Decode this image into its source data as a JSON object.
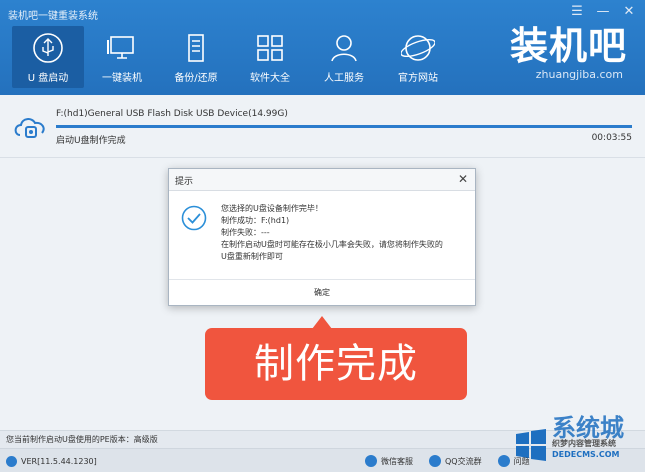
{
  "window": {
    "title": "装机吧一键重装系统",
    "controls": [
      "☰",
      "—",
      "✕"
    ]
  },
  "nav": [
    {
      "label": "U 盘启动",
      "icon": "usb-icon",
      "active": true
    },
    {
      "label": "一键装机",
      "icon": "monitor-icon",
      "active": false
    },
    {
      "label": "备份/还原",
      "icon": "backup-icon",
      "active": false
    },
    {
      "label": "软件大全",
      "icon": "apps-grid-icon",
      "active": false
    },
    {
      "label": "人工服务",
      "icon": "person-icon",
      "active": false
    },
    {
      "label": "官方网站",
      "icon": "globe-icon",
      "active": false
    }
  ],
  "brand": {
    "name": "装机吧",
    "url": "zhuangjiba.com"
  },
  "device": {
    "name": "F:(hd1)General USB Flash Disk USB Device(14.99G)",
    "status": "启动U盘制作完成",
    "time": "00:03:55",
    "progress_percent": 100
  },
  "dialog": {
    "title": "提示",
    "close": "✕",
    "lines": [
      "您选择的U盘设备制作完毕！",
      "制作成功：F:(hd1)",
      "制作失败：---",
      "在制作启动U盘时可能存在极小几率会失败，请您将制作失败的",
      "U盘重新制作即可"
    ],
    "ok_label": "确定"
  },
  "callout": {
    "text": "制作完成"
  },
  "info_bar": {
    "text": "您当前制作启动U盘使用的PE版本：高级版"
  },
  "status_bar": {
    "version": "VER[11.5.44.1230]",
    "links": [
      "微信客服",
      "QQ交流群",
      "问题"
    ]
  },
  "watermark": {
    "main": "系统城",
    "sub": "织梦内容管理系统",
    "url": "DEDECMS.COM"
  },
  "colors": {
    "header": "#2778c4",
    "accent": "#2b7ccc",
    "callout": "#f0553e"
  }
}
